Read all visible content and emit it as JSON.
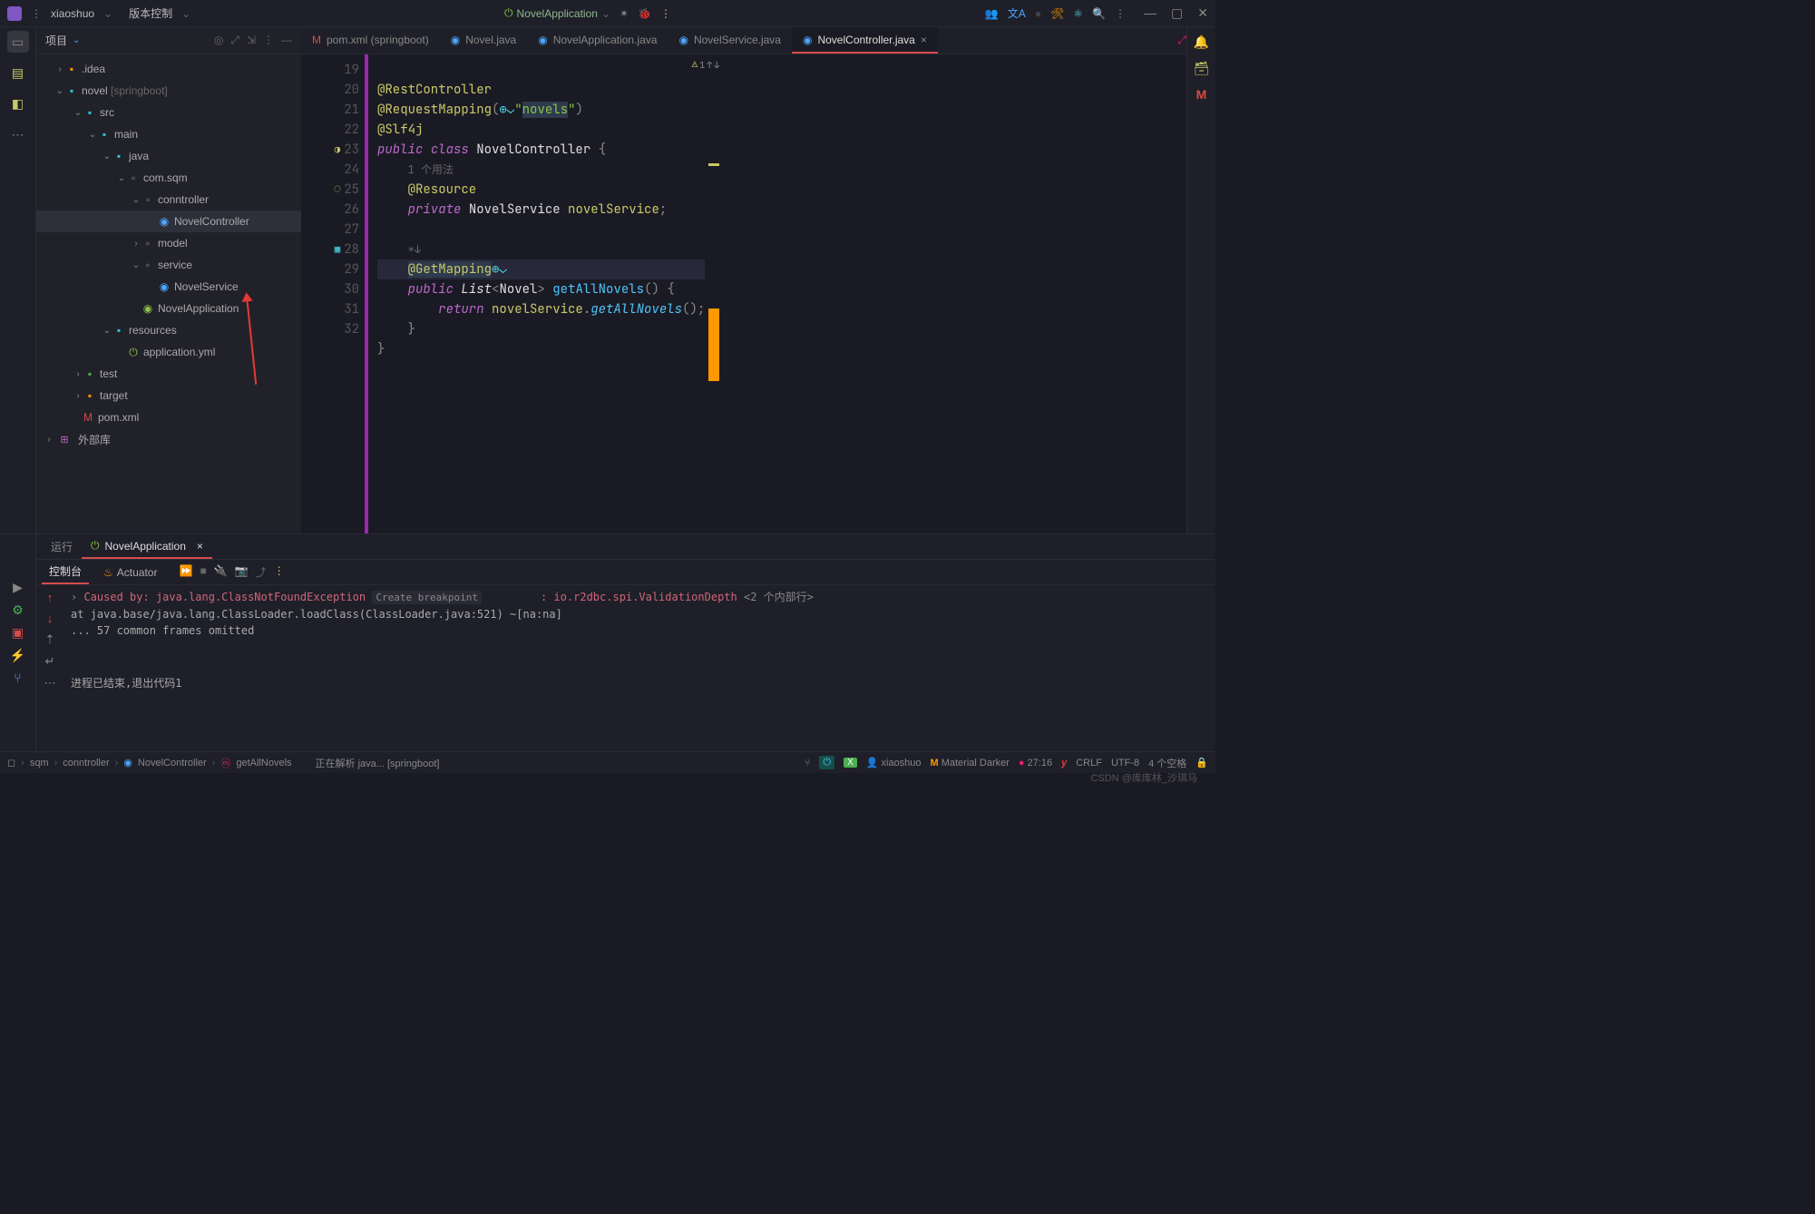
{
  "titlebar": {
    "project": "xiaoshuo",
    "vcs": "版本控制",
    "runConfig": "NovelApplication"
  },
  "projectPanel": {
    "title": "项目"
  },
  "tree": {
    "idea": ".idea",
    "novel": "novel",
    "novel_suffix": "[springboot]",
    "src": "src",
    "main": "main",
    "java": "java",
    "pkg": "com.sqm",
    "controller": "conntroller",
    "novelController": "NovelController",
    "model": "model",
    "service": "service",
    "novelService": "NovelService",
    "novelApp": "NovelApplication",
    "resources": "resources",
    "appYml": "application.yml",
    "test": "test",
    "target": "target",
    "pom": "pom.xml",
    "extLibs": "外部库"
  },
  "tabs": {
    "pom": "pom.xml (springboot)",
    "novel": "Novel.java",
    "novelApp": "NovelApplication.java",
    "novelService": "NovelService.java",
    "novelController": "NovelController.java"
  },
  "editor": {
    "lines": [
      "19",
      "20",
      "21",
      "22",
      "23",
      "24",
      "25",
      "26",
      "27",
      "28",
      "29",
      "30",
      "31",
      "32"
    ],
    "l20_a": "@RestController",
    "l21_a": "@RequestMapping",
    "l21_b": "(",
    "l21_c": "\"",
    "l21_d": "novels",
    "l21_e": "\"",
    "l21_f": ")",
    "l22_a": "@Slf4j",
    "l23_a": "public",
    "l23_b": "class",
    "l23_c": "NovelController",
    "l23_d": "{",
    "hint_usage": "1 个用法",
    "l24_a": "@Resource",
    "l25_a": "private",
    "l25_b": "NovelService",
    "l25_c": "novelService",
    "l25_d": ";",
    "l27_a": "@GetMapping",
    "l28_a": "public",
    "l28_b": "List",
    "l28_c": "<",
    "l28_d": "Novel",
    "l28_e": ">",
    "l28_f": "getAllNovels",
    "l28_g": "() {",
    "l29_a": "return",
    "l29_b": "novelService",
    "l29_c": ".",
    "l29_d": "getAllNovels",
    "l29_e": "();",
    "l30": "}",
    "l31": "}",
    "warn_count": "1"
  },
  "runPanel": {
    "runLabel": "运行",
    "appName": "NovelApplication",
    "console": "控制台",
    "actuator": "Actuator",
    "line1_a": "Caused by: java.lang.ClassNotFoundException",
    "line1_btn": "Create breakpoint",
    "line1_b": ": io.r2dbc.spi.ValidationDepth",
    "line1_c": "<2 个内部行>",
    "line2": "    at java.base/java.lang.ClassLoader.loadClass(ClassLoader.java:521) ~[na:na]",
    "line3": "    ... 57 common frames omitted",
    "exit": "进程已结束,退出代码1"
  },
  "breadcrumb": {
    "b1": "sqm",
    "b2": "conntroller",
    "b3": "NovelController",
    "b4": "getAllNovels",
    "b5": "正在解析 java... [springboot]"
  },
  "status": {
    "user": "xiaoshuo",
    "theme": "Material Darker",
    "cursor": "27:16",
    "crlf": "CRLF",
    "enc": "UTF-8",
    "indent": "4 个空格"
  },
  "watermark": "CSDN @库库林_沙琪马"
}
